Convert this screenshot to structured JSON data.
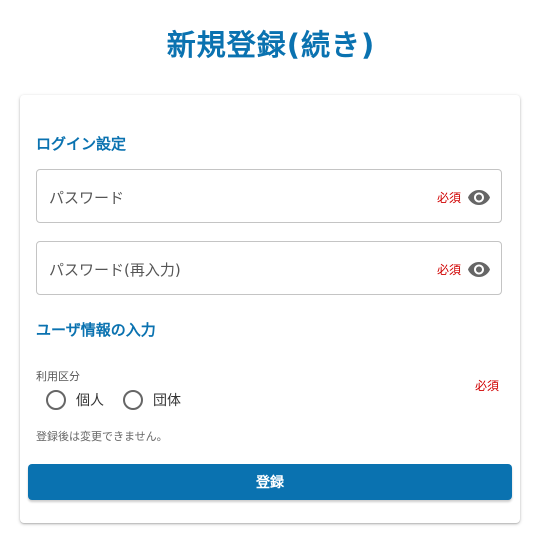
{
  "page": {
    "title": "新規登録(続き)"
  },
  "login_section": {
    "title": "ログイン設定",
    "password": {
      "label": "パスワード",
      "required": "必須",
      "icon": "eye-icon"
    },
    "password_confirm": {
      "label": "パスワード(再入力)",
      "required": "必須",
      "icon": "eye-icon"
    }
  },
  "user_section": {
    "title": "ユーザ情報の入力",
    "usage_type": {
      "label": "利用区分",
      "required": "必須",
      "options": [
        "個人",
        "団体"
      ],
      "selected": null
    },
    "helper": "登録後は変更できません。"
  },
  "actions": {
    "submit_label": "登録"
  },
  "colors": {
    "accent": "#0a72b0",
    "required": "#d00000",
    "border": "#c4c4c4"
  }
}
